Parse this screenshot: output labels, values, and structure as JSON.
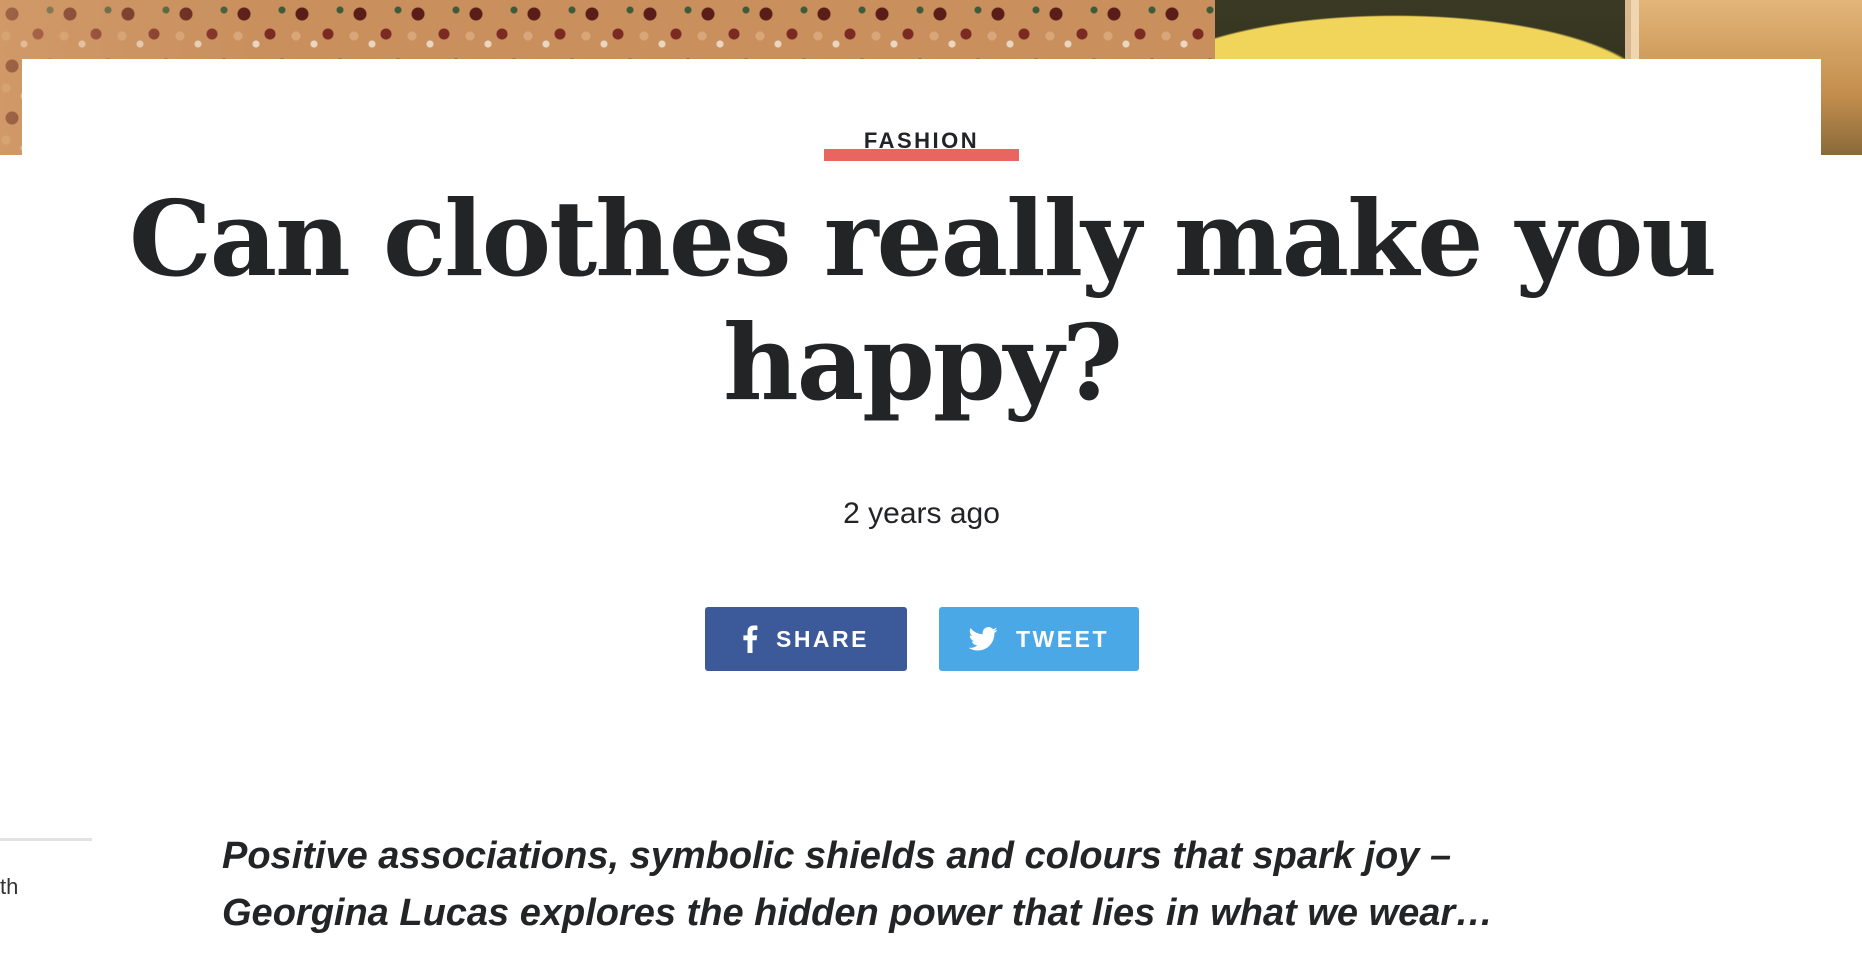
{
  "article": {
    "category": "FASHION",
    "title": "Can clothes really make you happy?",
    "published": "2 years ago",
    "standfirst": "Positive associations, symbolic shields and colours that spark joy – Georgina Lucas explores the hidden power that lies in what we wear…"
  },
  "share": {
    "facebook_label": "SHARE",
    "twitter_label": "TWEET"
  },
  "sidebar": {
    "fragment_text": "th"
  },
  "colors": {
    "category_bar": "#e8665f",
    "facebook": "#3c5a99",
    "twitter": "#4aa8e6",
    "text": "#232426"
  },
  "icons": {
    "facebook": "facebook-icon",
    "twitter": "twitter-bird-icon"
  }
}
